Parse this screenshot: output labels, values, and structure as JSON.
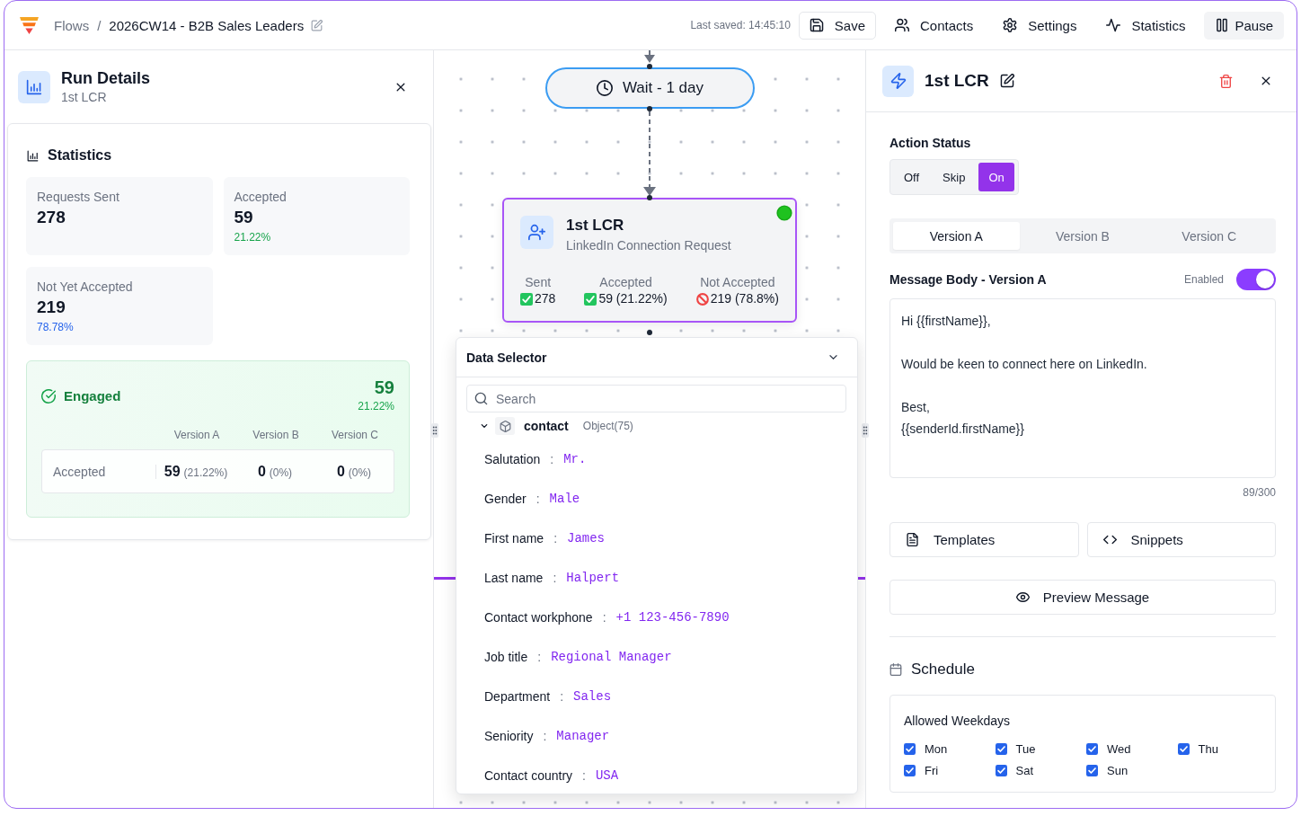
{
  "topbar": {
    "breadcrumb": [
      {
        "label": "Flows"
      },
      {
        "label": "2026CW14 - B2B Sales Leaders"
      }
    ],
    "separator": "/",
    "last_saved": "Last saved: 14:45:10",
    "actions": [
      {
        "kind": "save",
        "label": "Save"
      },
      {
        "kind": "contacts",
        "label": "Contacts"
      },
      {
        "kind": "settings",
        "label": "Settings"
      },
      {
        "kind": "statistics",
        "label": "Statistics"
      },
      {
        "kind": "pause",
        "label": "Pause"
      }
    ]
  },
  "run_details": {
    "title": "Run Details",
    "subtitle": "1st LCR",
    "statistics": {
      "heading": "Statistics",
      "cards": [
        {
          "label": "Requests Sent",
          "value": "278"
        },
        {
          "label": "Accepted",
          "value": "59",
          "percent": "21.22%",
          "color": "#16a34a"
        },
        {
          "label": "Not Yet Accepted",
          "value": "219",
          "percent": "78.78%",
          "color": "#2563eb"
        }
      ]
    },
    "engaged": {
      "label": "Engaged",
      "value": "59",
      "percent": "21.22%",
      "columns": [
        "Version A",
        "Version B",
        "Version C"
      ],
      "rows": [
        {
          "label": "Accepted",
          "cells": [
            {
              "value": "59",
              "percent": "(21.22%)"
            },
            {
              "value": "0",
              "percent": "(0%)"
            },
            {
              "value": "0",
              "percent": "(0%)"
            }
          ]
        }
      ]
    }
  },
  "canvas": {
    "nodes": [
      {
        "kind": "wait",
        "label": "Wait - 1 day",
        "selected": false
      },
      {
        "kind": "action",
        "title": "1st LCR",
        "subtitle": "LinkedIn Connection Request",
        "selected": true,
        "active": true,
        "stats": [
          {
            "label": "Sent",
            "value": "278",
            "kind": "success"
          },
          {
            "label": "Accepted",
            "value": "59 (21.22%)",
            "kind": "success"
          },
          {
            "label": "Not Accepted",
            "value": "219 (78.8%)",
            "kind": "blocked"
          }
        ]
      }
    ],
    "data_selector": {
      "title": "Data Selector",
      "search": {
        "placeholder": "Search"
      },
      "group": {
        "name": "contact",
        "type": "Object(75)",
        "expanded": true,
        "children": [
          {
            "label": "Salutation",
            "separator": ":",
            "value": "Mr."
          },
          {
            "label": "Gender",
            "separator": ":",
            "value": "Male"
          },
          {
            "label": "First name",
            "separator": ":",
            "value": "James"
          },
          {
            "label": "Last name",
            "separator": ":",
            "value": "Halpert"
          },
          {
            "label": "Contact workphone",
            "separator": ":",
            "value": "+1 123-456-7890"
          },
          {
            "label": "Job title",
            "separator": ":",
            "value": "Regional Manager"
          },
          {
            "label": "Department",
            "separator": ":",
            "value": "Sales"
          },
          {
            "label": "Seniority",
            "separator": ":",
            "value": "Manager"
          },
          {
            "label": "Contact country",
            "separator": ":",
            "value": "USA"
          }
        ]
      }
    }
  },
  "details": {
    "title": "1st LCR",
    "action_status": {
      "label": "Action Status",
      "options": [
        {
          "label": "Off",
          "selected": false
        },
        {
          "label": "Skip",
          "selected": false
        },
        {
          "label": "On",
          "selected": true
        }
      ]
    },
    "versions": [
      {
        "label": "Version A",
        "selected": true
      },
      {
        "label": "Version B",
        "selected": false
      },
      {
        "label": "Version C",
        "selected": false
      }
    ],
    "message": {
      "label": "Message Body - Version A",
      "toggle_label": "Enabled",
      "enabled": true,
      "body": "Hi {{firstName}},\n\nWould be keen to connect here on LinkedIn.\n\nBest,\n{{senderId.firstName}}",
      "counter": "89/300"
    },
    "actions": [
      {
        "kind": "templates",
        "label": "Templates"
      },
      {
        "kind": "snippets",
        "label": "Snippets"
      },
      {
        "kind": "preview",
        "label": "Preview Message"
      }
    ],
    "schedule": {
      "heading": "Schedule",
      "weekdays_label": "Allowed Weekdays",
      "days": [
        {
          "label": "Mon",
          "checked": true
        },
        {
          "label": "Tue",
          "checked": true
        },
        {
          "label": "Wed",
          "checked": true
        },
        {
          "label": "Thu",
          "checked": true
        },
        {
          "label": "Fri",
          "checked": true
        },
        {
          "label": "Sat",
          "checked": true
        },
        {
          "label": "Sun",
          "checked": true
        }
      ]
    }
  }
}
